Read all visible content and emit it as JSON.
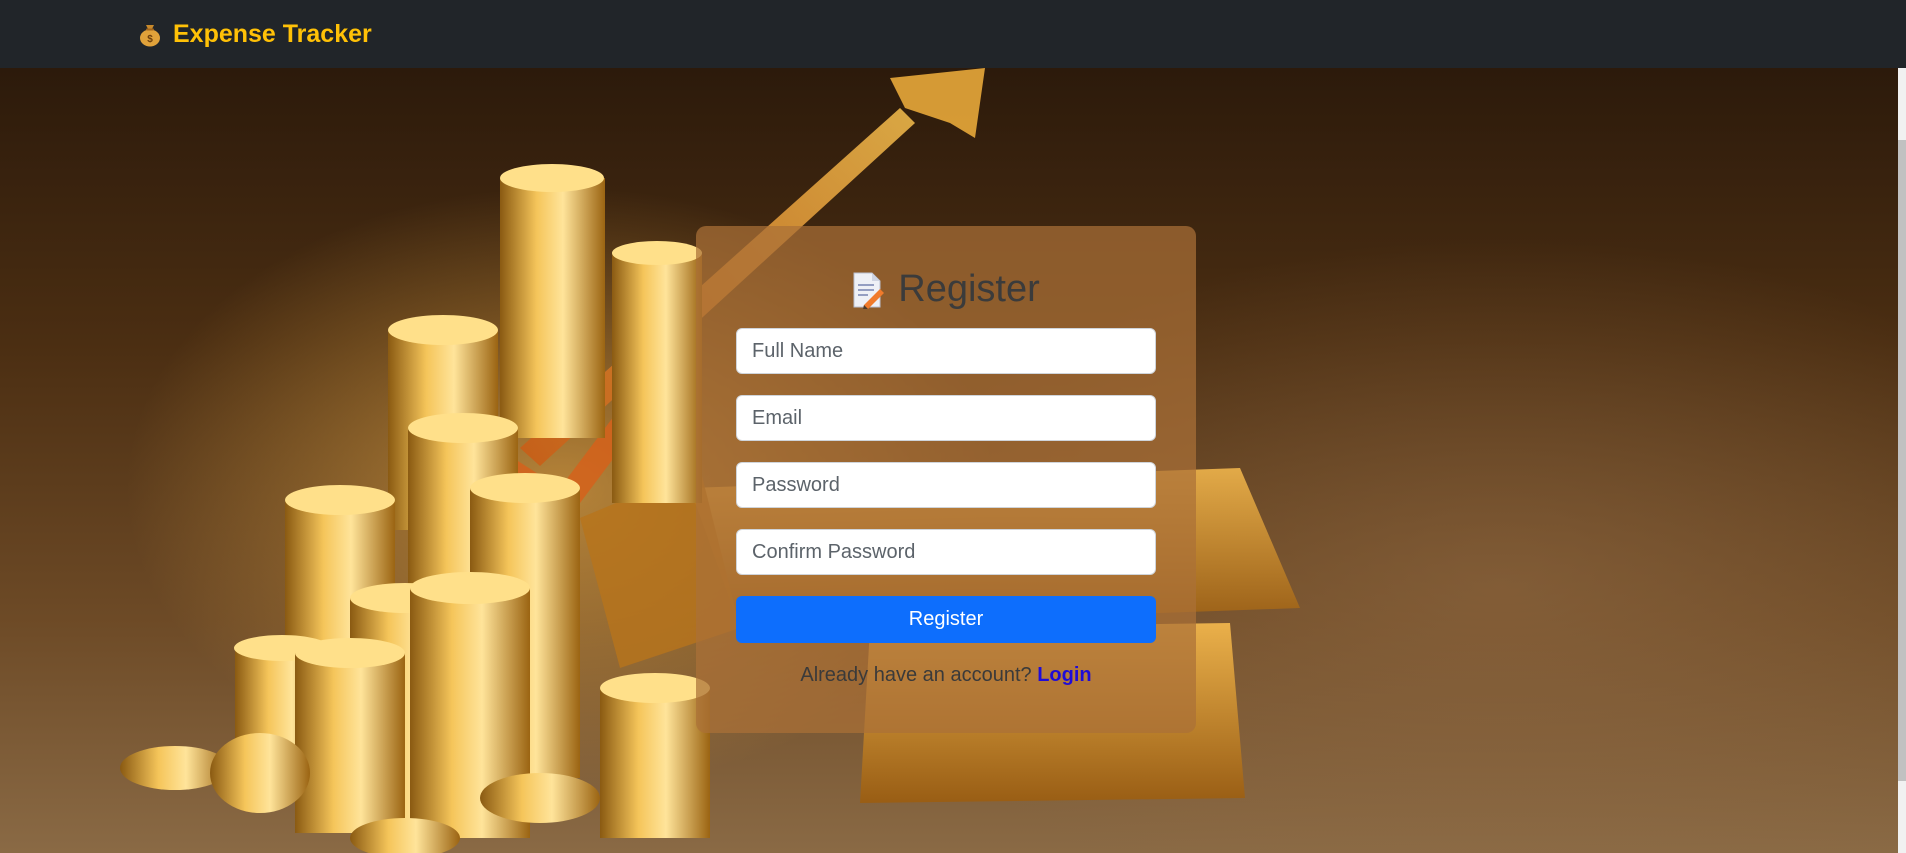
{
  "brand": {
    "name": "Expense Tracker",
    "icon": "money-bag-icon"
  },
  "hero": {
    "image": "gold-coins-and-bars-background"
  },
  "register": {
    "title": "Register",
    "title_icon": "document-pencil-icon",
    "full_name_placeholder": "Full Name",
    "email_placeholder": "Email",
    "password_placeholder": "Password",
    "confirm_password_placeholder": "Confirm Password",
    "submit_label": "Register",
    "footer_text": "Already have an account? ",
    "login_link": "Login"
  },
  "colors": {
    "navbar": "#212529",
    "brand": "#ffc107",
    "button": "#0d6efd",
    "link": "#1f0bd8"
  }
}
